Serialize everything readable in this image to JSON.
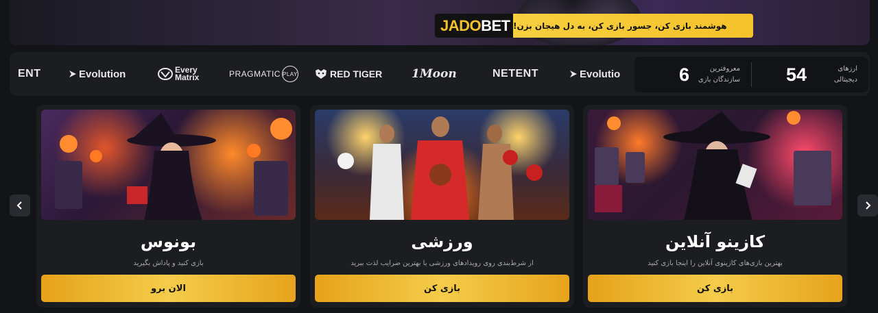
{
  "banner": {
    "logo_part1": "JADO",
    "logo_part2": "BET",
    "text": "هوشمند بازی کن، جسور بازی کن، به دل هیجان بزن!"
  },
  "providers": [
    {
      "name": "NETENT",
      "display": "ENT"
    },
    {
      "name": "Evolution",
      "display": "Evolution"
    },
    {
      "name": "Every Matrix",
      "display_line1": "Every",
      "display_line2": "Matrix"
    },
    {
      "name": "Pragmatic Play",
      "display": "PRAGMATIC",
      "badge": "PLAY"
    },
    {
      "name": "Red Tiger",
      "display": "RED TIGER"
    },
    {
      "name": "1Moon",
      "display": "1Moon"
    },
    {
      "name": "NETENT",
      "display": "NETENT"
    },
    {
      "name": "Evolution",
      "display": "Evolutio"
    }
  ],
  "stats": {
    "providers_count": "6",
    "providers_label": "معروفترین سازندگان بازی",
    "currencies_count": "54",
    "currencies_label": "ارزهای دیجیتالی"
  },
  "cards": [
    {
      "title": "بونوس",
      "desc": "بازی کنید و پاداش بگیرید",
      "cta": "الان برو"
    },
    {
      "title": "ورزشی",
      "desc": "از شرط‌بندی روی رویدادهای ورزشی با بهترین ضرایب لذت ببرید",
      "cta": "بازی کن"
    },
    {
      "title": "کازینو آنلاین",
      "desc": "بهترین بازی‌های کازینوی آنلاین را اینجا بازی کنید",
      "cta": "بازی کن"
    }
  ],
  "colors": {
    "accent": "#f4cc4a",
    "background": "#131417",
    "panel": "#1c1d21"
  }
}
